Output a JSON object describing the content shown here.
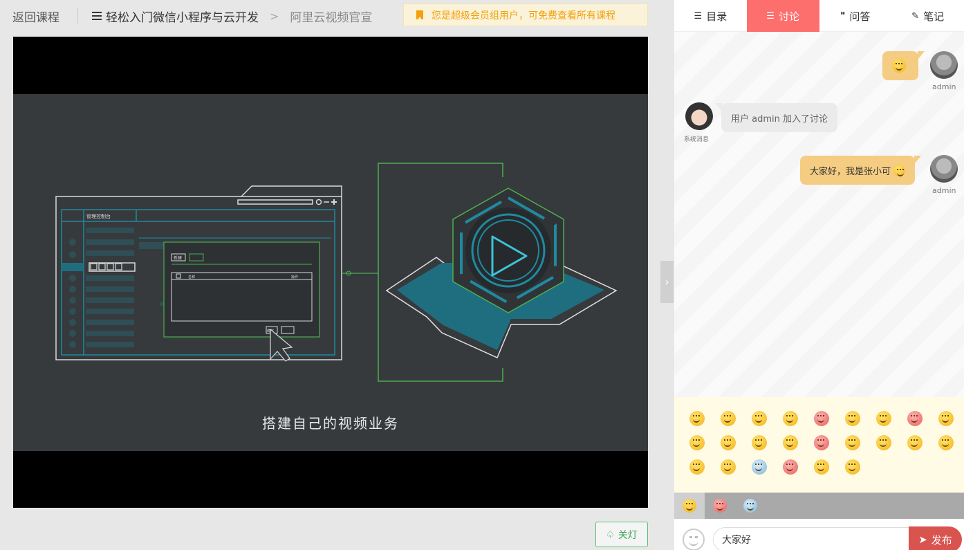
{
  "topbar": {
    "back_label": "返回课程",
    "course_title": "轻松入门微信小程序与云开发",
    "breadcrumb_separator": ">",
    "lesson_title": "阿里云视频官宣",
    "vip_notice": "您是超级会员组用户，可免费查看所有课程"
  },
  "video": {
    "dashboard_title": "管理控制台",
    "dialog_button_new": "新建",
    "dialog_confirm": "确定",
    "dialog_col_name": "名称",
    "dialog_col_action": "操作",
    "caption": "搭建自己的视频业务",
    "accent_color": "#1f6e80",
    "line_color": "#4caf50"
  },
  "controls": {
    "lamp_label": "关灯",
    "toggle_glyph": "›"
  },
  "panel": {
    "tabs": [
      {
        "label": "目录",
        "icon": "menu-icon"
      },
      {
        "label": "讨论",
        "icon": "menu-icon",
        "active": true
      },
      {
        "label": "问答",
        "icon": "qa-icon"
      },
      {
        "label": "笔记",
        "icon": "pen-icon"
      }
    ],
    "messages": [
      {
        "from": "admin",
        "text": "",
        "emoji": "smile",
        "side": "right"
      },
      {
        "from": "系统消息",
        "text": "用户 admin 加入了讨论",
        "side": "left"
      },
      {
        "from": "admin",
        "text": "大家好，我是张小可",
        "emoji": "smile",
        "side": "right"
      }
    ],
    "emoji_tabs": [
      "smile-face",
      "pink-face",
      "blue-face"
    ],
    "input_value": "大家好",
    "send_label": "发布"
  },
  "colors": {
    "active_tab": "#fc6f6d",
    "my_bubble": "#f4cc82",
    "send_button": "#d9534f",
    "vip_text": "#f2a00c"
  }
}
